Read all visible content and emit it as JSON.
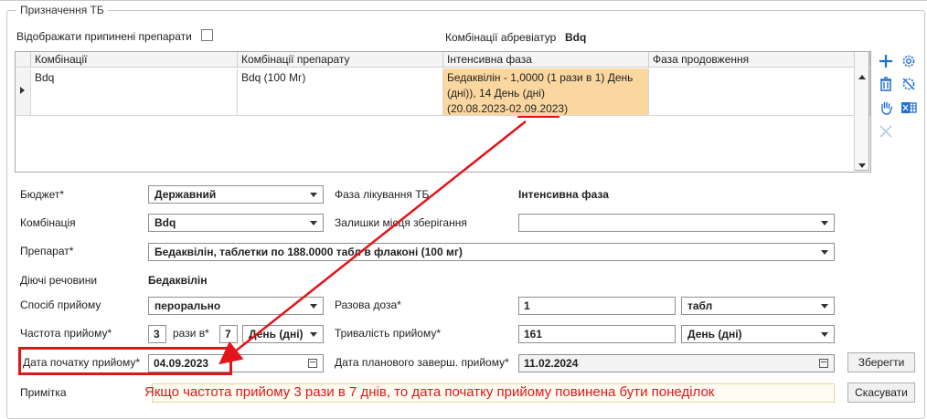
{
  "group": {
    "title": "Призначення ТБ"
  },
  "top": {
    "show_stopped_label": "Відображати припинені препарати",
    "abbr_label": "Комбінації абревіатур",
    "abbr_value": "Bdq"
  },
  "grid": {
    "headers": [
      "Комбінації",
      "Комбінації препарату",
      "Інтенсивна фаза",
      "Фаза продовження"
    ],
    "row": {
      "combination": "Bdq",
      "drug_combination": "Bdq (100 Мг)",
      "intensive_line1": "Бедаквілін - 1,0000 (1 рази в 1) День",
      "intensive_line2": "(дні)), 14 День (дні)",
      "intensive_line3": "(20.08.2023-02.09.2023)",
      "continuation": ""
    }
  },
  "toolbar": {
    "icons": [
      "add-icon",
      "settings-gear-icon",
      "delete-trash-icon",
      "settings-cross-icon",
      "hand-icon",
      "excel-export-icon",
      "close-icon"
    ]
  },
  "form": {
    "budget_label": "Бюджет*",
    "budget_value": "Державний",
    "phase_label": "Фаза лікування ТБ",
    "phase_value": "Інтенсивна фаза",
    "combination_label": "Комбінація",
    "combination_value": "Bdq",
    "storage_label": "Залишки місця зберігання",
    "storage_value": "",
    "drug_label": "Препарат*",
    "drug_value": "Бедаквілін, таблетки по 188.0000 табл в флаконі (100 мг)",
    "active_label": "Діючі речовини",
    "active_value": "Бедаквілін",
    "route_label": "Спосіб прийому",
    "route_value": "перорально",
    "dose_label": "Разова доза*",
    "dose_value": "1",
    "dose_unit": "табл",
    "freq_label": "Частота прийому*",
    "freq_times": "3",
    "freq_times_label": "рази в*",
    "freq_period": "7",
    "freq_unit": "День (дні)",
    "duration_label": "Тривалість прийому*",
    "duration_value": "161",
    "duration_unit": "День (дні)",
    "start_label": "Дата початку прийому*",
    "start_value": "04.09.2023",
    "planned_end_label": "Дата планового заверш. прийому*",
    "planned_end_value": "11.02.2024",
    "save_label": "Зберегти",
    "note_label": "Примітка",
    "cancel_label": "Скасувати"
  },
  "annotation": {
    "text": "Якщо частота прийому 3 рази в 7 днів, то дата початку прийому повинена бути понеділок",
    "color": "#e3141a"
  },
  "colors": {
    "highlight_cell": "#fbd7a0",
    "accent_blue": "#1f6fd1"
  }
}
